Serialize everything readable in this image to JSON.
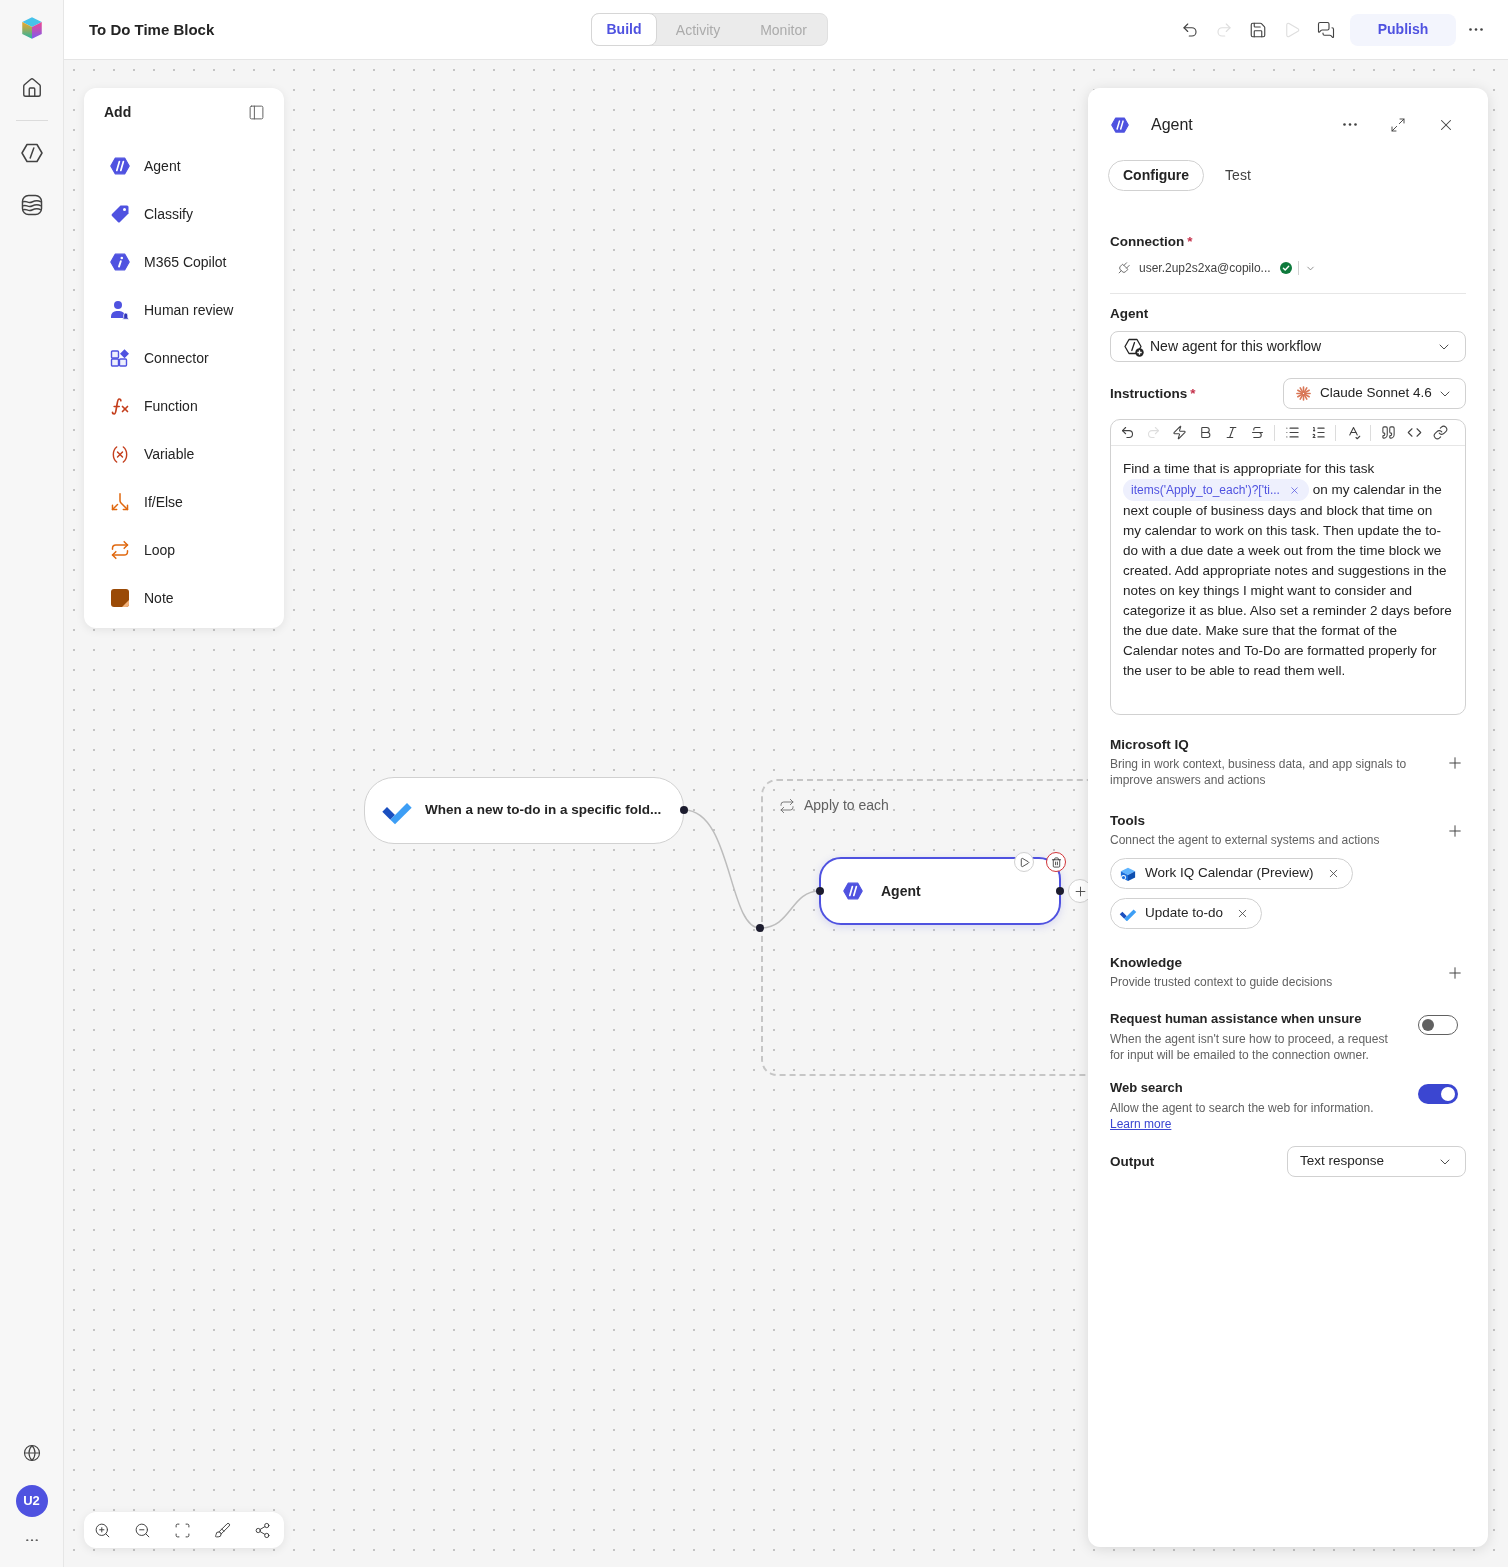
{
  "app": {
    "title": "To Do Time Block",
    "avatar": "U2"
  },
  "view_tabs": [
    {
      "label": "Build",
      "selected": true,
      "disabled": false
    },
    {
      "label": "Activity",
      "selected": false,
      "disabled": true
    },
    {
      "label": "Monitor",
      "selected": false,
      "disabled": true
    }
  ],
  "toolbar": {
    "actions": [
      {
        "disabled": false
      },
      {
        "disabled": true
      },
      {
        "disabled": false
      },
      {
        "disabled": true
      },
      {
        "disabled": false
      }
    ],
    "publish": "Publish"
  },
  "add_panel": {
    "title": "Add",
    "items": [
      {
        "label": "Agent"
      },
      {
        "label": "Classify"
      },
      {
        "label": "M365 Copilot"
      },
      {
        "label": "Human review"
      },
      {
        "label": "Connector"
      },
      {
        "label": "Function"
      },
      {
        "label": "Variable"
      },
      {
        "label": "If/Else"
      },
      {
        "label": "Loop"
      },
      {
        "label": "Note"
      }
    ]
  },
  "canvas": {
    "trigger": {
      "label": "When a new to-do in a specific fold..."
    },
    "loop": {
      "label": "Apply to each"
    },
    "agent_node": {
      "label": "Agent",
      "selected": true
    }
  },
  "panel": {
    "title": "Agent",
    "tabs": [
      {
        "label": "Configure",
        "selected": true
      },
      {
        "label": "Test",
        "selected": false
      }
    ],
    "connection": {
      "label": "Connection",
      "required_mark": "*",
      "value": "user.2up2s2xa@copilo...",
      "connected": true
    },
    "agent": {
      "label": "Agent",
      "value": "New agent for this workflow"
    },
    "instructions": {
      "label": "Instructions",
      "required_mark": "*",
      "model": "Claude Sonnet 4.6",
      "editor_toolbar": [
        {
          "disabled": false
        },
        {
          "disabled": true
        },
        {
          "disabled": false
        },
        {
          "disabled": false
        },
        {
          "disabled": false
        },
        {
          "disabled": false
        },
        {
          "disabled": false
        },
        {
          "disabled": false
        },
        {
          "disabled": false
        },
        {
          "disabled": false
        },
        {
          "disabled": false
        },
        {
          "disabled": false
        }
      ],
      "text_before": "Find a time that is appropriate for this task",
      "token": "items('Apply_to_each')?['ti...",
      "text_after": "on my calendar in the next couple of business days and block that time on my calendar to work on this task. Then update the to-do with a due date a week out from the time block we created. Add appropriate notes and suggestions in the notes on key things I might want to consider and categorize it as blue. Also set a reminder 2 days before the due date. Make sure that the format of the Calendar notes and To-Do are formatted properly for the user to be able to read them well."
    },
    "sections": [
      {
        "title": "Microsoft IQ",
        "description": "Bring in work context, business data, and app signals to improve answers and actions"
      },
      {
        "title": "Tools",
        "description": "Connect the agent to external systems and actions",
        "tools": [
          {
            "label": "Work IQ Calendar (Preview)"
          },
          {
            "label": "Update to-do"
          }
        ]
      },
      {
        "title": "Knowledge",
        "description": "Provide trusted context to guide decisions"
      }
    ],
    "toggles": [
      {
        "title": "Request human assistance when unsure",
        "description": "When the agent isn't sure how to proceed, a request for input will be emailed to the connection owner.",
        "on": false
      },
      {
        "title": "Web search",
        "description": "Allow the agent to search the web for information.",
        "link": "Learn more",
        "on": true
      }
    ],
    "output": {
      "label": "Output",
      "value": "Text response"
    }
  }
}
